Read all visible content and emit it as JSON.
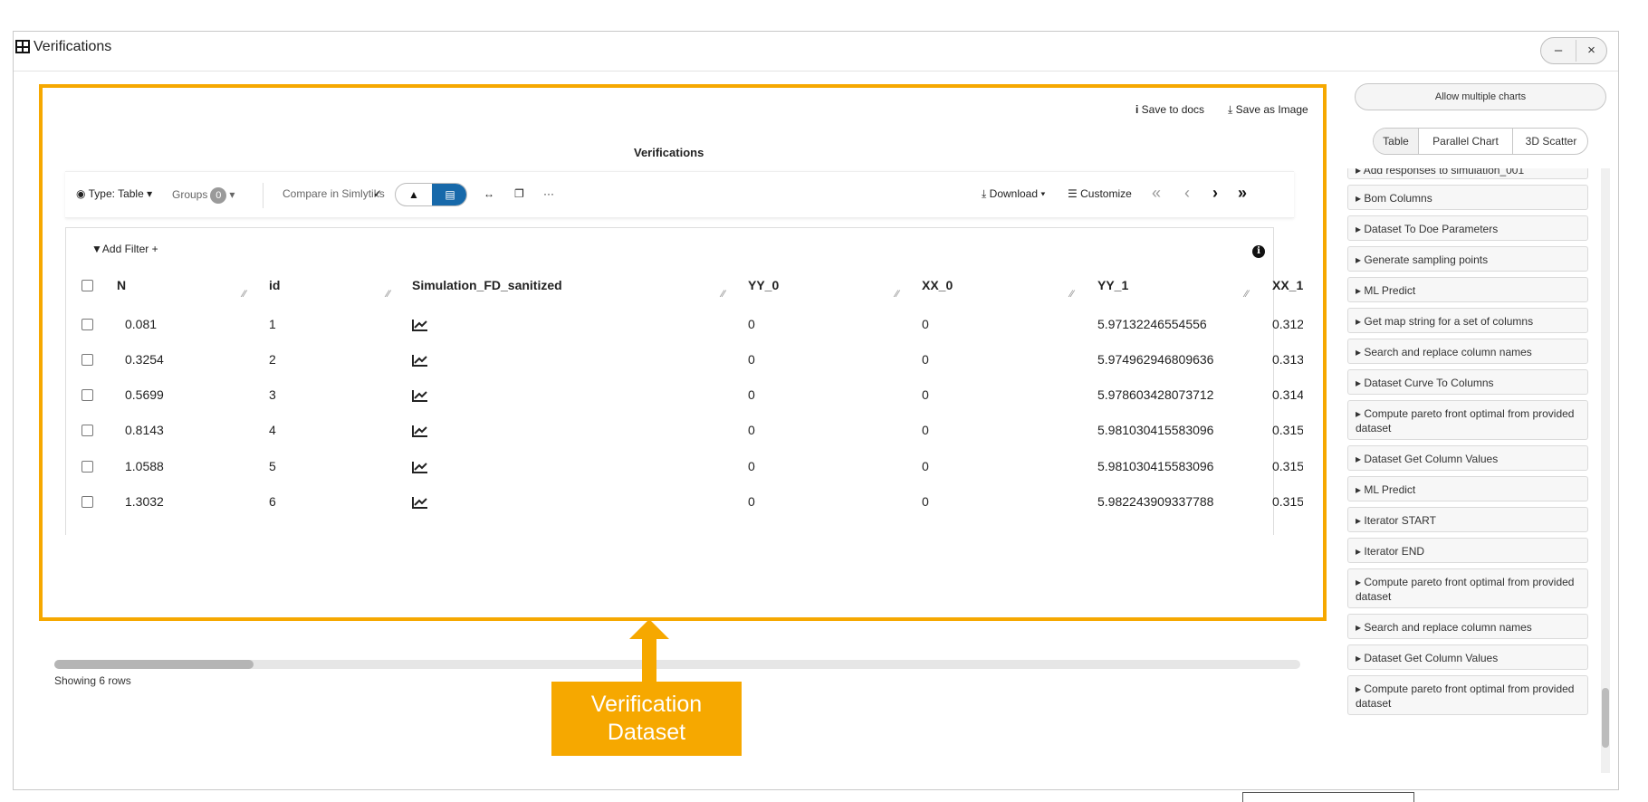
{
  "window": {
    "title": "Verifications",
    "minimize": "–",
    "close": "×"
  },
  "panel": {
    "save_to_docs": "Save to docs",
    "save_as_image": "Save as Image",
    "title": "Verifications"
  },
  "toolbar": {
    "type_label": "Type: Table",
    "groups_label": "Groups",
    "groups_count": "0",
    "compare": "Compare in Simlytiks",
    "more": "···",
    "download": "Download",
    "customize": "Customize"
  },
  "table": {
    "add_filter": "Add Filter +",
    "columns": [
      "N",
      "id",
      "Simulation_FD_sanitized",
      "YY_0",
      "XX_0",
      "YY_1",
      "XX_1"
    ],
    "rows": [
      {
        "n": "0.081",
        "id": "1",
        "yy0": "0",
        "xx0": "0",
        "yy1": "5.97132246554556",
        "xx1": "0.312"
      },
      {
        "n": "0.3254",
        "id": "2",
        "yy0": "0",
        "xx0": "0",
        "yy1": "5.974962946809636",
        "xx1": "0.313"
      },
      {
        "n": "0.5699",
        "id": "3",
        "yy0": "0",
        "xx0": "0",
        "yy1": "5.978603428073712",
        "xx1": "0.314"
      },
      {
        "n": "0.8143",
        "id": "4",
        "yy0": "0",
        "xx0": "0",
        "yy1": "5.981030415583096",
        "xx1": "0.315"
      },
      {
        "n": "1.0588",
        "id": "5",
        "yy0": "0",
        "xx0": "0",
        "yy1": "5.981030415583096",
        "xx1": "0.315"
      },
      {
        "n": "1.3032",
        "id": "6",
        "yy0": "0",
        "xx0": "0",
        "yy1": "5.982243909337788",
        "xx1": "0.315"
      }
    ],
    "status": "Showing 6 rows"
  },
  "annotation": {
    "line1": "Verification",
    "line2": "Dataset",
    "color": "#f6a800"
  },
  "right_panel": {
    "multi_charts": "Allow multiple charts",
    "tabs": [
      "Table",
      "Parallel Chart",
      "3D Scatter"
    ],
    "functions": [
      "Add responses to simulation_001",
      "Bom Columns",
      "Dataset To Doe Parameters",
      "Generate sampling points",
      "ML Predict",
      "Get map string for a set of columns",
      "Search and replace column names",
      "Dataset Curve To Columns",
      "Compute pareto front optimal from provided dataset",
      "Dataset Get Column Values",
      "ML Predict",
      "Iterator START",
      "Iterator END",
      "Compute pareto front optimal from provided dataset",
      "Search and replace column names",
      "Dataset Get Column Values",
      "Compute pareto front optimal from provided dataset"
    ]
  }
}
